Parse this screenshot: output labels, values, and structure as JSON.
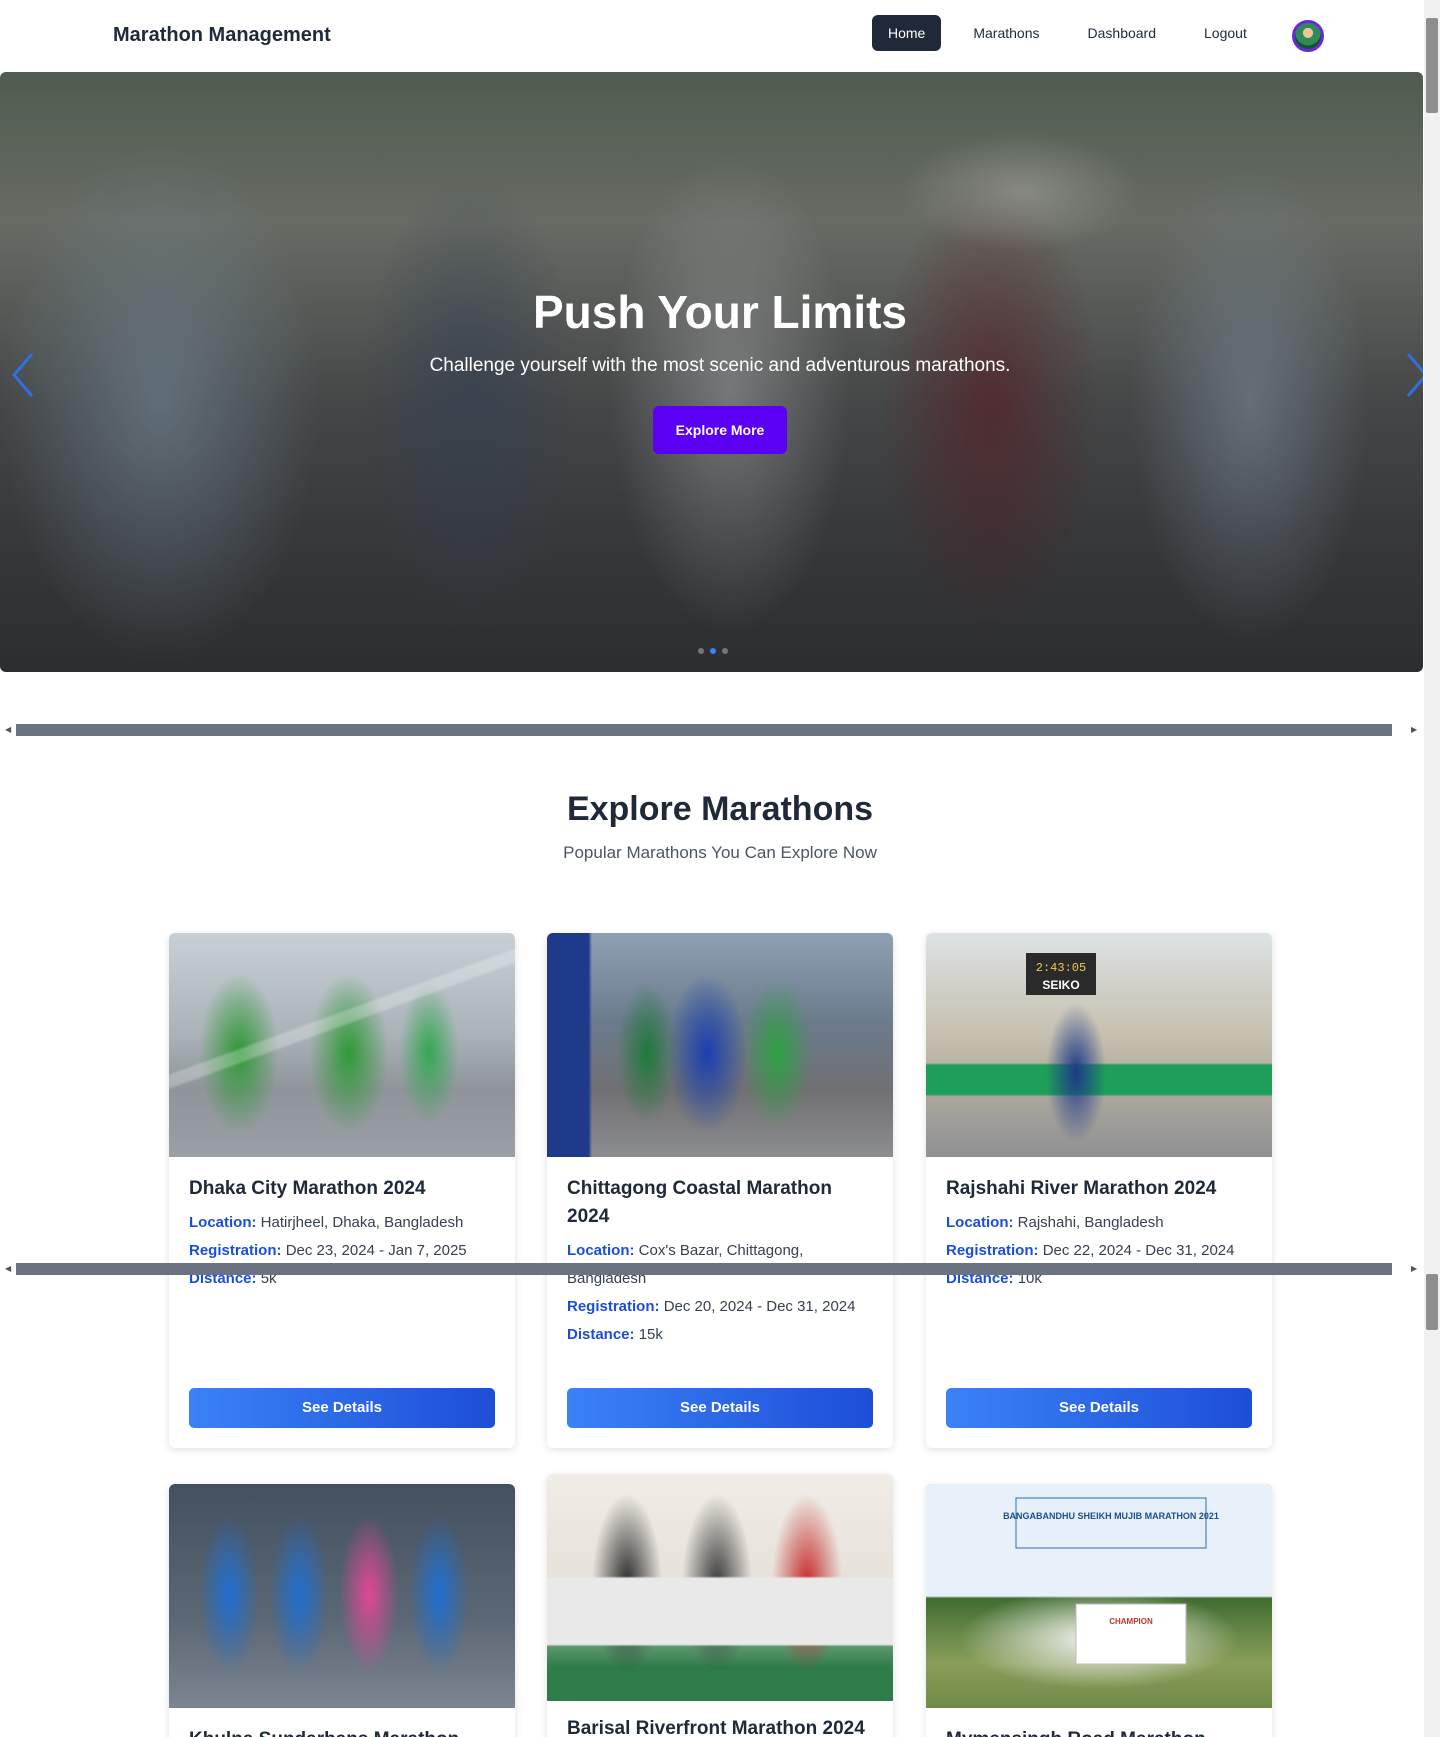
{
  "brand": "Marathon Management",
  "nav": {
    "home": "Home",
    "marathons": "Marathons",
    "dashboard": "Dashboard",
    "logout": "Logout"
  },
  "hero": {
    "title": "Push Your Limits",
    "subtitle": "Challenge yourself with the most scenic and adventurous marathons.",
    "button": "Explore More"
  },
  "section": {
    "title": "Explore Marathons",
    "subtitle": "Popular Marathons You Can Explore Now"
  },
  "labels": {
    "location": "Location:",
    "registration": "Registration:",
    "distance": "Distance:",
    "details": "See Details"
  },
  "cards": [
    {
      "title": "Dhaka City Marathon 2024",
      "location": "Hatirjheel, Dhaka, Bangladesh",
      "registration": "Dec 23, 2024 - Jan 7, 2025",
      "distance": "5k"
    },
    {
      "title": "Chittagong Coastal Marathon 2024",
      "location": "Cox's Bazar, Chittagong, Bangladesh",
      "registration": "Dec 20, 2024 - Dec 31, 2024",
      "distance": "15k"
    },
    {
      "title": "Rajshahi River Marathon 2024",
      "location": "Rajshahi, Bangladesh",
      "registration": "Dec 22, 2024 - Dec 31, 2024",
      "distance": "10k"
    },
    {
      "title": "Khulna Sundarbans Marathon"
    },
    {
      "title": "Barisal Riverfront Marathon 2024"
    },
    {
      "title": "Mymensingh Road Marathon"
    }
  ],
  "image_texts": {
    "timer": "2:43:05",
    "timer_brand": "SEIKO",
    "banner": "BANGABANDHU SHEIKH MUJIB MARATHON 2021",
    "certificate": "CHAMPION"
  }
}
